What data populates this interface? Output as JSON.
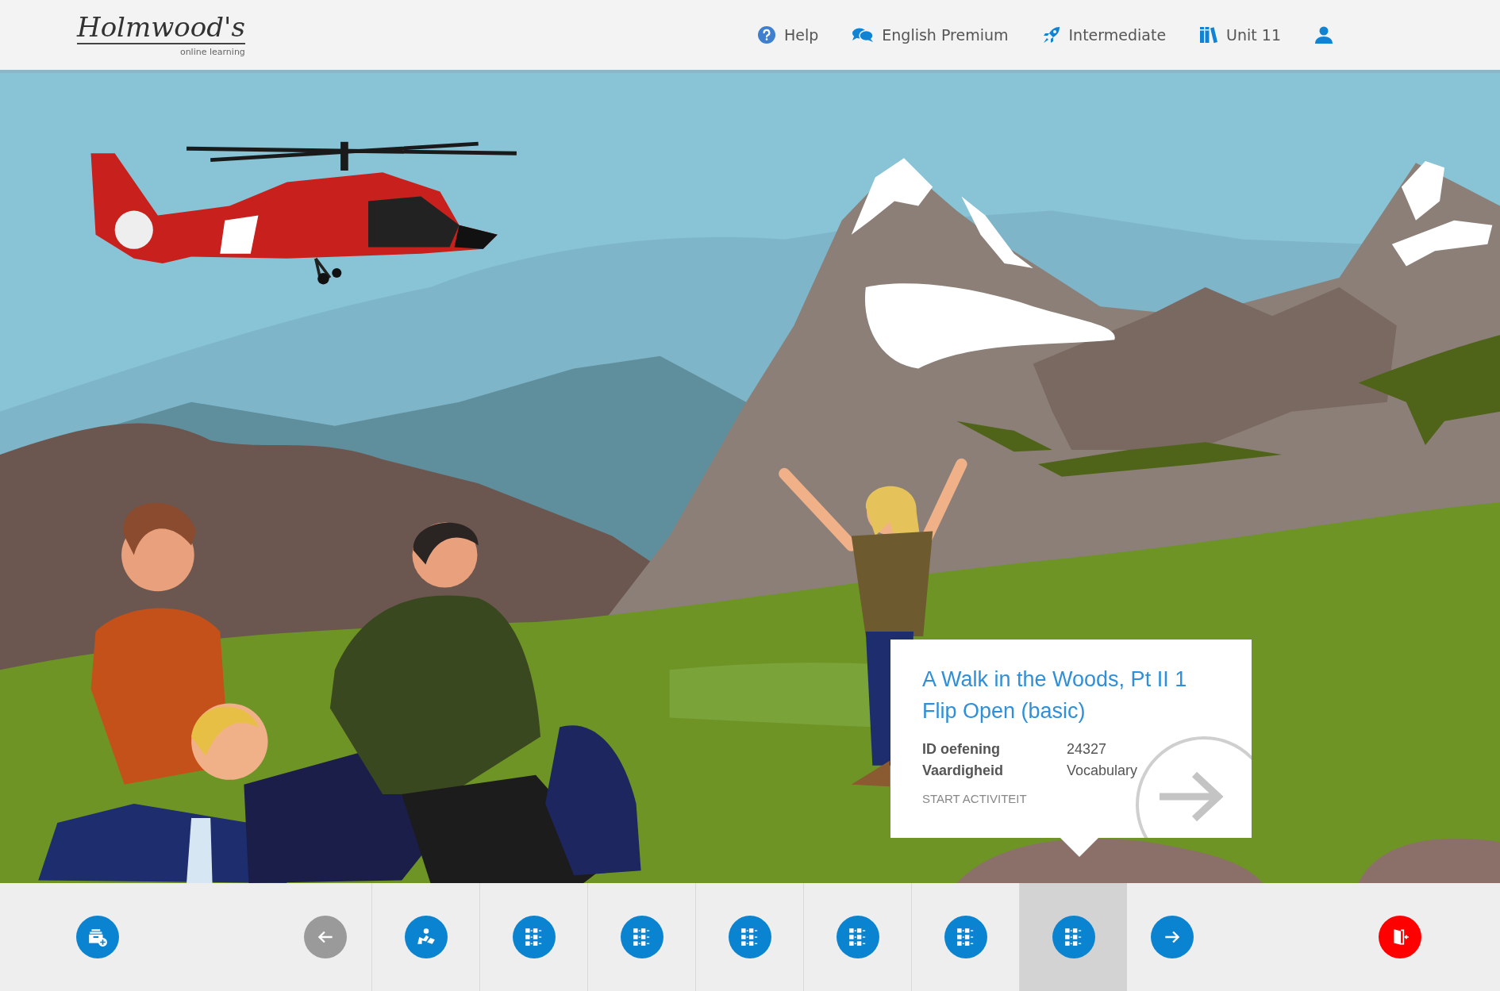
{
  "header": {
    "logo": {
      "name": "Holmwood's",
      "tagline": "online learning"
    },
    "nav": [
      {
        "kind": "help",
        "label": "Help"
      },
      {
        "kind": "course",
        "label": "English Premium"
      },
      {
        "kind": "level",
        "label": "Intermediate"
      },
      {
        "kind": "unit",
        "label": "Unit 11"
      },
      {
        "kind": "account"
      }
    ]
  },
  "activity_card": {
    "title": "A Walk in the Woods, Pt II 1 Flip Open (basic)",
    "details": [
      {
        "label": "ID oefening",
        "value": "24327"
      },
      {
        "label": "Vaardigheid",
        "value": "Vocabulary"
      }
    ],
    "action": "START ACTIVITEIT"
  },
  "toolbar": {
    "previous": {
      "disabled": true
    },
    "steps": [
      {
        "kind": "reading",
        "selected": false
      },
      {
        "kind": "exercise",
        "selected": false
      },
      {
        "kind": "exercise",
        "selected": false
      },
      {
        "kind": "exercise",
        "selected": false
      },
      {
        "kind": "exercise",
        "selected": false
      },
      {
        "kind": "exercise",
        "selected": false
      },
      {
        "kind": "exercise",
        "selected": true
      }
    ],
    "next": {
      "disabled": false
    }
  }
}
